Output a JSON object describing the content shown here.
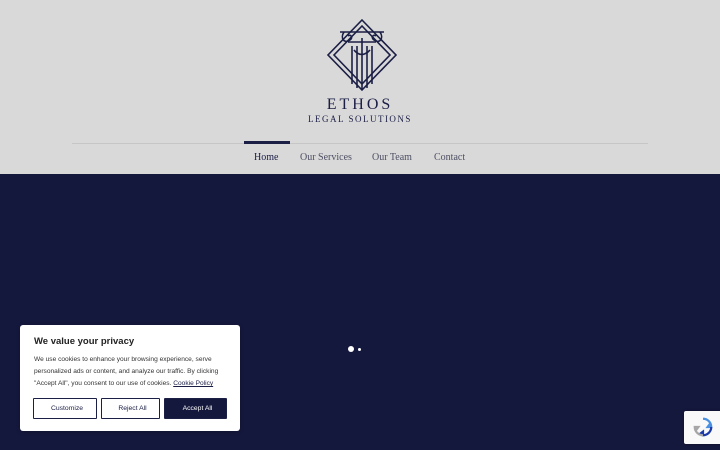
{
  "brand": {
    "name": "ETHOS",
    "tagline": "LEGAL SOLUTIONS"
  },
  "nav": {
    "items": [
      {
        "label": "Home",
        "active": true
      },
      {
        "label": "Our Services",
        "active": false
      },
      {
        "label": "Our Team",
        "active": false
      },
      {
        "label": "Contact",
        "active": false
      }
    ]
  },
  "colors": {
    "navy": "#15183d",
    "header_bg": "#d9d9d9",
    "accent": "#1b1e45"
  },
  "cookie_banner": {
    "title": "We value your privacy",
    "body": "We use cookies to enhance your browsing experience, serve personalized ads or content, and analyze our traffic. By clicking \"Accept All\", you consent to our use of cookies.",
    "link": "Cookie Policy",
    "buttons": {
      "customize": "Customize",
      "reject": "Reject All",
      "accept": "Accept All"
    }
  },
  "slider": {
    "slide_count": 2,
    "active_index": 0
  },
  "icons": {
    "logo": "pillar-crest-icon",
    "recaptcha": "recaptcha-icon"
  }
}
